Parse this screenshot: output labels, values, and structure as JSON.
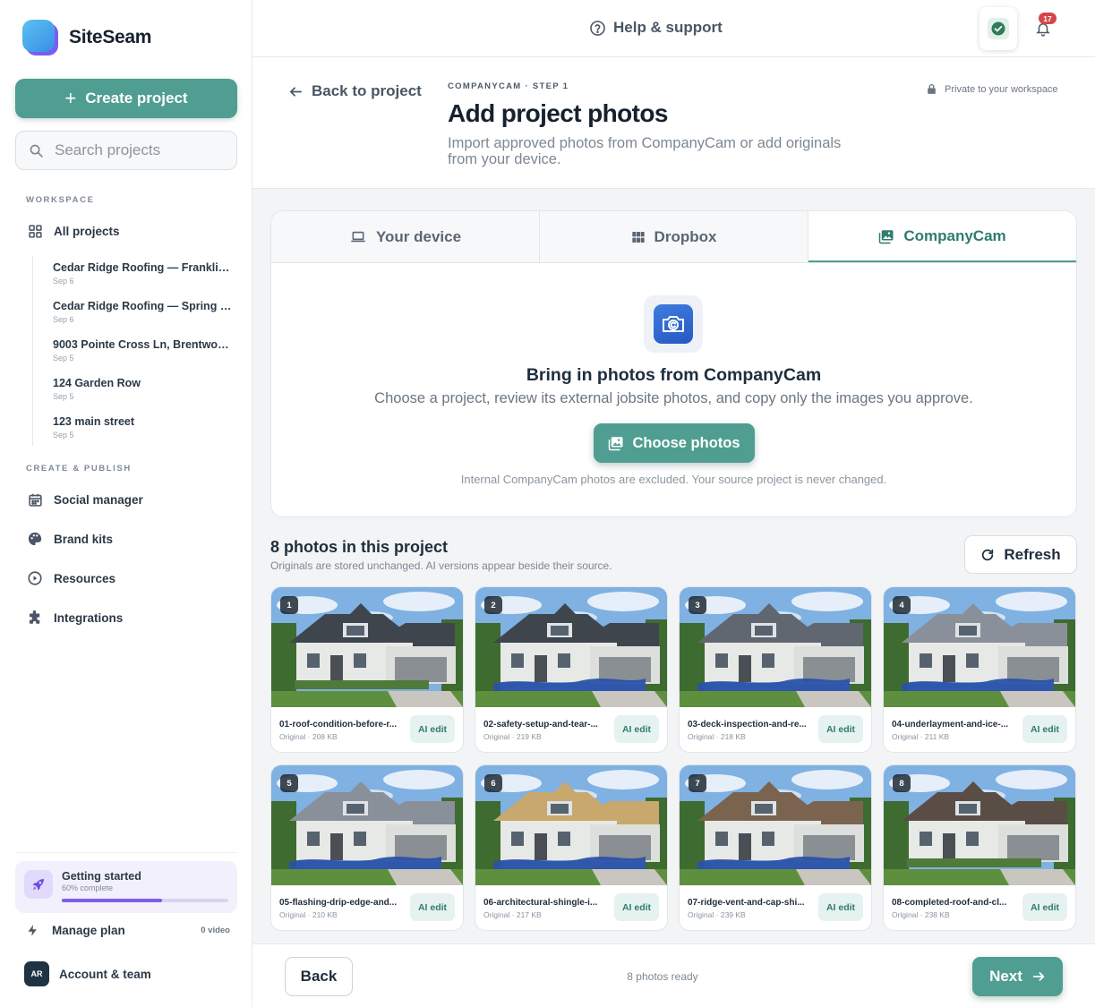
{
  "app": {
    "name": "SiteSeam"
  },
  "sidebar": {
    "create_label": "Create project",
    "search_placeholder": "Search projects",
    "workspace_label": "WORKSPACE",
    "all_projects": "All projects",
    "projects": [
      {
        "name": "Cedar Ridge Roofing — Franklin ...",
        "date": "Sep 6"
      },
      {
        "name": "Cedar Ridge Roofing — Spring R...",
        "date": "Sep 6"
      },
      {
        "name": "9003 Pointe Cross Ln, Brentwoo...",
        "date": "Sep 5"
      },
      {
        "name": "124 Garden Row",
        "date": "Sep 5"
      },
      {
        "name": "123 main street",
        "date": "Sep 5"
      }
    ],
    "create_publish_label": "CREATE & PUBLISH",
    "nav": [
      {
        "label": "Social manager",
        "icon": "calendar-icon"
      },
      {
        "label": "Brand kits",
        "icon": "palette-icon"
      },
      {
        "label": "Resources",
        "icon": "play-circle-icon"
      },
      {
        "label": "Integrations",
        "icon": "puzzle-icon"
      }
    ],
    "getting_started": {
      "title": "Getting started",
      "subtitle": "60% complete",
      "progress": 0.6
    },
    "manage_plan": {
      "label": "Manage plan",
      "count": "0 video"
    },
    "account": {
      "initials": "AR",
      "label": "Account & team"
    }
  },
  "topbar": {
    "help_label": "Help & support",
    "notifications_count": "17",
    "status_color": "#2f7c59"
  },
  "header": {
    "back_label": "Back to project",
    "step_label": "COMPANYCAM · STEP 1",
    "title": "Add project photos",
    "description": "Import approved photos from CompanyCam or add originals from your device.",
    "privacy": "Private to your workspace"
  },
  "import": {
    "tabs": [
      {
        "label": "Your device",
        "icon": "laptop-icon"
      },
      {
        "label": "Dropbox",
        "icon": "grid-icon"
      },
      {
        "label": "CompanyCam",
        "icon": "image-icon",
        "active": true
      }
    ],
    "title": "Bring in photos from CompanyCam",
    "description": "Choose a project, review its external jobsite photos, and copy only the images you approve.",
    "choose_label": "Choose photos",
    "note": "Internal CompanyCam photos are excluded. Your source project is never changed."
  },
  "photos": {
    "title": "8 photos in this project",
    "subtitle": "Originals are stored unchanged. AI versions appear beside their source.",
    "refresh_label": "Refresh",
    "ai_label": "AI edit",
    "items": [
      {
        "num": "1",
        "name": "01-roof-condition-before-r...",
        "meta": "Original · 208 KB"
      },
      {
        "num": "2",
        "name": "02-safety-setup-and-tear-...",
        "meta": "Original · 219 KB"
      },
      {
        "num": "3",
        "name": "03-deck-inspection-and-re...",
        "meta": "Original · 218 KB"
      },
      {
        "num": "4",
        "name": "04-underlayment-and-ice-...",
        "meta": "Original · 211 KB"
      },
      {
        "num": "5",
        "name": "05-flashing-drip-edge-and...",
        "meta": "Original · 210 KB"
      },
      {
        "num": "6",
        "name": "06-architectural-shingle-i...",
        "meta": "Original · 217 KB"
      },
      {
        "num": "7",
        "name": "07-ridge-vent-and-cap-shi...",
        "meta": "Original · 239 KB"
      },
      {
        "num": "8",
        "name": "08-completed-roof-and-cl...",
        "meta": "Original · 238 KB"
      }
    ]
  },
  "footer": {
    "back_label": "Back",
    "ready_text": "8 photos ready",
    "next_label": "Next"
  },
  "colors": {
    "accent": "#4f9e91",
    "accent_dark": "#2f7c70",
    "brand_purple": "#7b5cf0",
    "badge_red": "#d6454a"
  }
}
